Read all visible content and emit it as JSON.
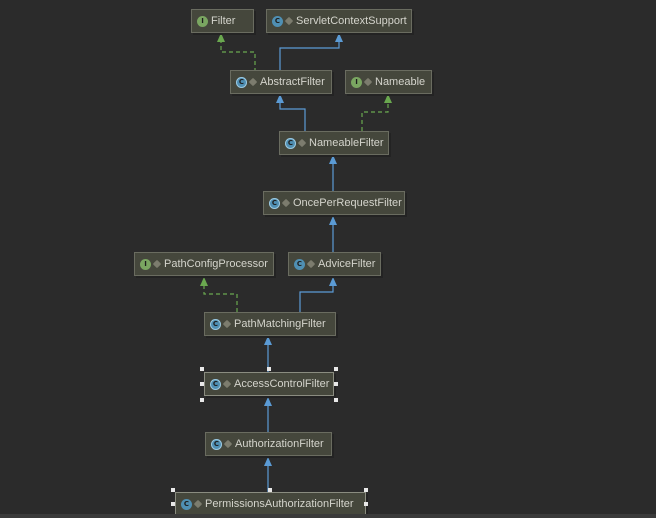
{
  "nodes": {
    "filter": {
      "label": "Filter",
      "kind": "interface",
      "icon_letter": "I"
    },
    "servlet_context_support": {
      "label": "ServletContextSupport",
      "kind": "class",
      "icon_letter": "C"
    },
    "abstract_filter": {
      "label": "AbstractFilter",
      "kind": "abstract",
      "icon_letter": "C"
    },
    "nameable": {
      "label": "Nameable",
      "kind": "interface",
      "icon_letter": "I"
    },
    "nameable_filter": {
      "label": "NameableFilter",
      "kind": "abstract",
      "icon_letter": "C"
    },
    "once_per_request_filter": {
      "label": "OncePerRequestFilter",
      "kind": "abstract",
      "icon_letter": "C"
    },
    "path_config_processor": {
      "label": "PathConfigProcessor",
      "kind": "interface",
      "icon_letter": "I"
    },
    "advice_filter": {
      "label": "AdviceFilter",
      "kind": "class",
      "icon_letter": "C"
    },
    "path_matching_filter": {
      "label": "PathMatchingFilter",
      "kind": "abstract",
      "icon_letter": "C"
    },
    "access_control_filter": {
      "label": "AccessControlFilter",
      "kind": "abstract",
      "icon_letter": "C"
    },
    "authorization_filter": {
      "label": "AuthorizationFilter",
      "kind": "abstract",
      "icon_letter": "C"
    },
    "permissions_authorization_filter": {
      "label": "PermissionsAuthorizationFilter",
      "kind": "class",
      "icon_letter": "C"
    }
  },
  "colors": {
    "background": "#2b2b2b",
    "extends_arrow": "#5b9bd5",
    "implements_arrow": "#6aa84f"
  }
}
